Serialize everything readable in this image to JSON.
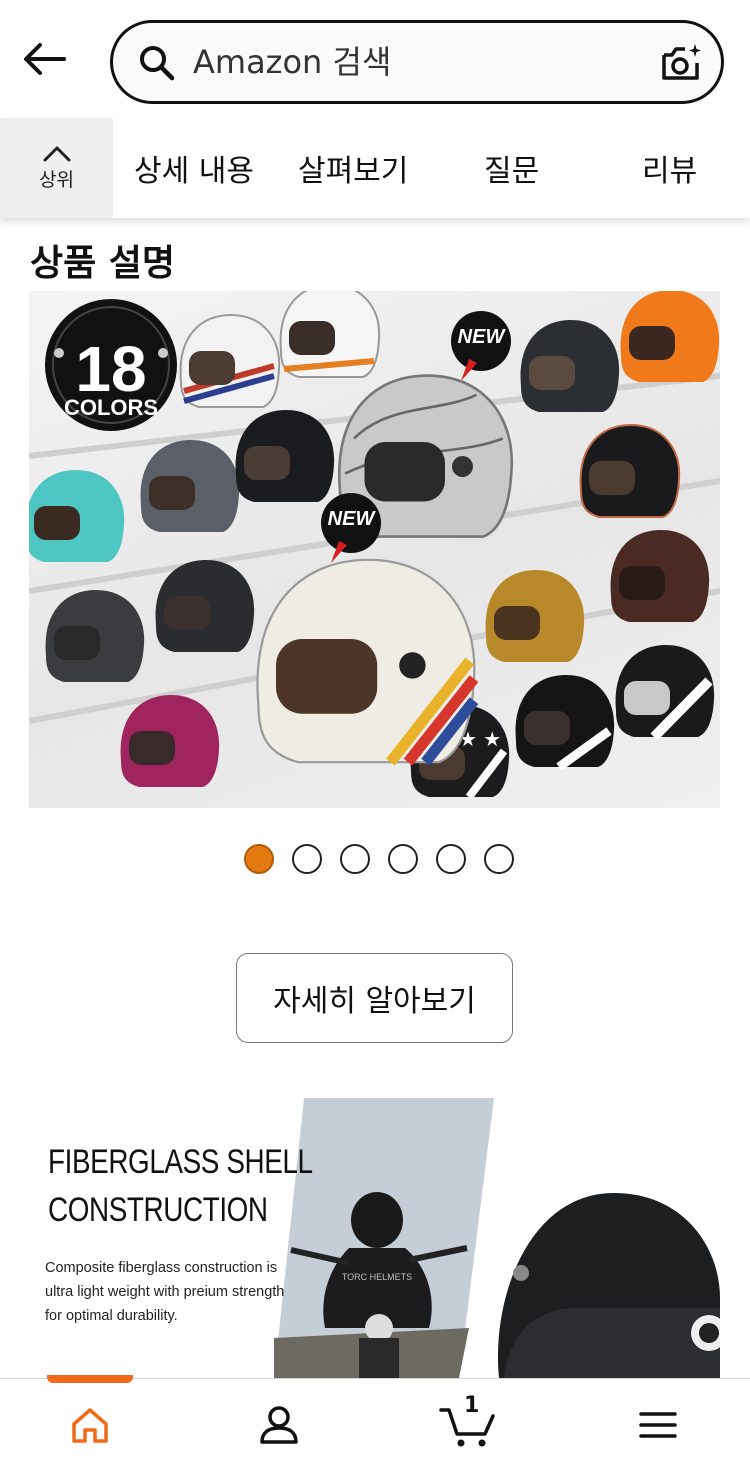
{
  "header": {
    "back_icon": "arrow-left-icon",
    "search_placeholder": "Amazon 검색",
    "search_icon": "search-icon",
    "camera_icon": "camera-search-icon"
  },
  "tabs": {
    "top_label": "상위",
    "items": [
      {
        "label": "상세 내용"
      },
      {
        "label": "살펴보기"
      },
      {
        "label": "질문"
      },
      {
        "label": "리뷰"
      }
    ]
  },
  "section": {
    "title": "상품 설명"
  },
  "carousel": {
    "badge_number": "18",
    "badge_text": "COLORS",
    "new_badge": "NEW",
    "total_slides": 6,
    "active_slide": 1
  },
  "learn_more_label": "자세히 알아보기",
  "promo": {
    "title_line1": "FIBERGLASS SHELL",
    "title_line2": "CONSTRUCTION",
    "description": "Composite fiberglass construction is ultra light weight with preium strength for optimal durability.",
    "jacket_text": "TORC HELMETS"
  },
  "bottom_nav": {
    "items": [
      {
        "icon": "home-icon"
      },
      {
        "icon": "account-icon"
      },
      {
        "icon": "cart-icon",
        "count": "1"
      },
      {
        "icon": "menu-icon"
      }
    ],
    "accent_color": "#f06a18"
  }
}
